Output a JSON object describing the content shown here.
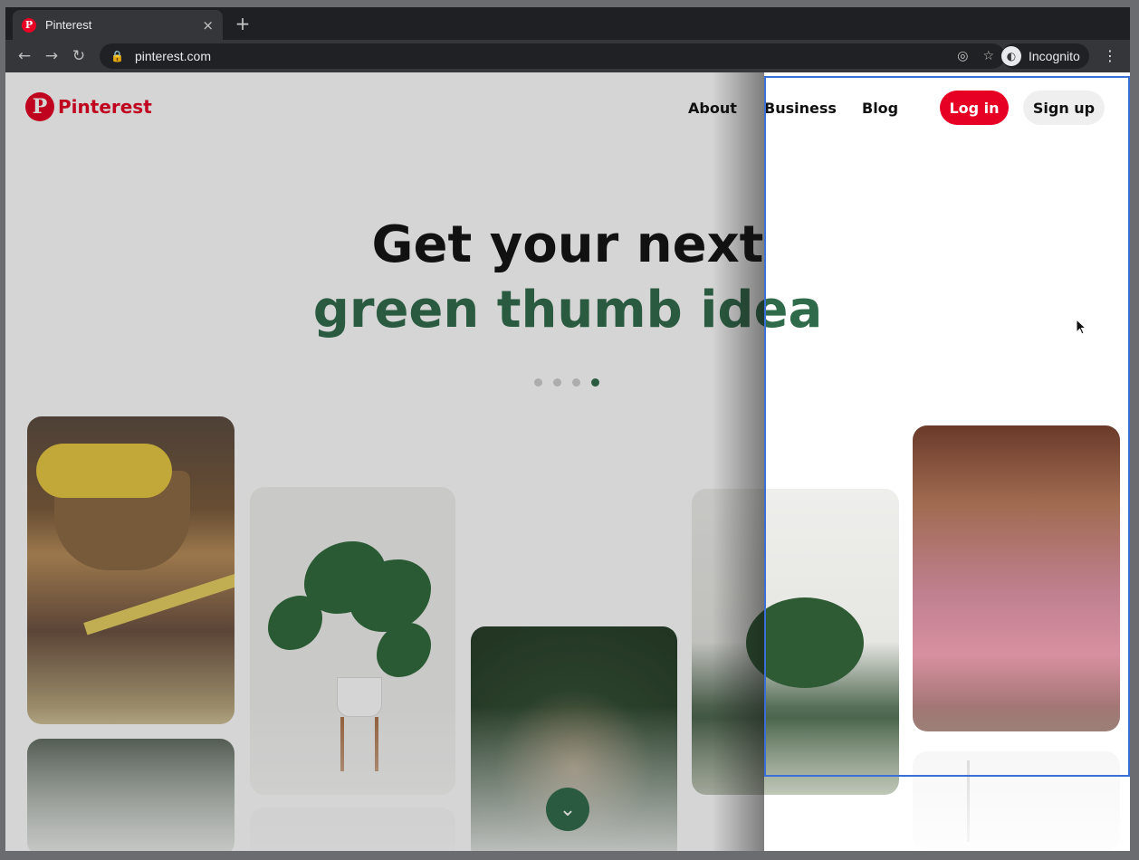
{
  "browser": {
    "tab_title": "Pinterest",
    "tab_close": "×",
    "new_tab": "+",
    "url": "pinterest.com",
    "incognito_label": "Incognito",
    "menu": "⋮"
  },
  "header": {
    "logo_text": "Pinterest",
    "nav": [
      "About",
      "Business",
      "Blog"
    ],
    "login_label": "Log in",
    "signup_label": "Sign up"
  },
  "hero": {
    "line1": "Get your next",
    "line2": "green thumb idea",
    "carousel_active_dot": 4,
    "carousel_dot_count": 4
  },
  "colors": {
    "brand": "#e60023",
    "accent_green": "#2f6b4a",
    "selection_blue": "#3a6fd8"
  },
  "icons": {
    "back": "back-arrow-icon",
    "forward": "forward-arrow-icon",
    "reload": "reload-icon",
    "lock": "lock-icon",
    "eye_off": "eye-off-icon",
    "star": "star-icon",
    "scroll_down": "chevron-down-icon"
  }
}
